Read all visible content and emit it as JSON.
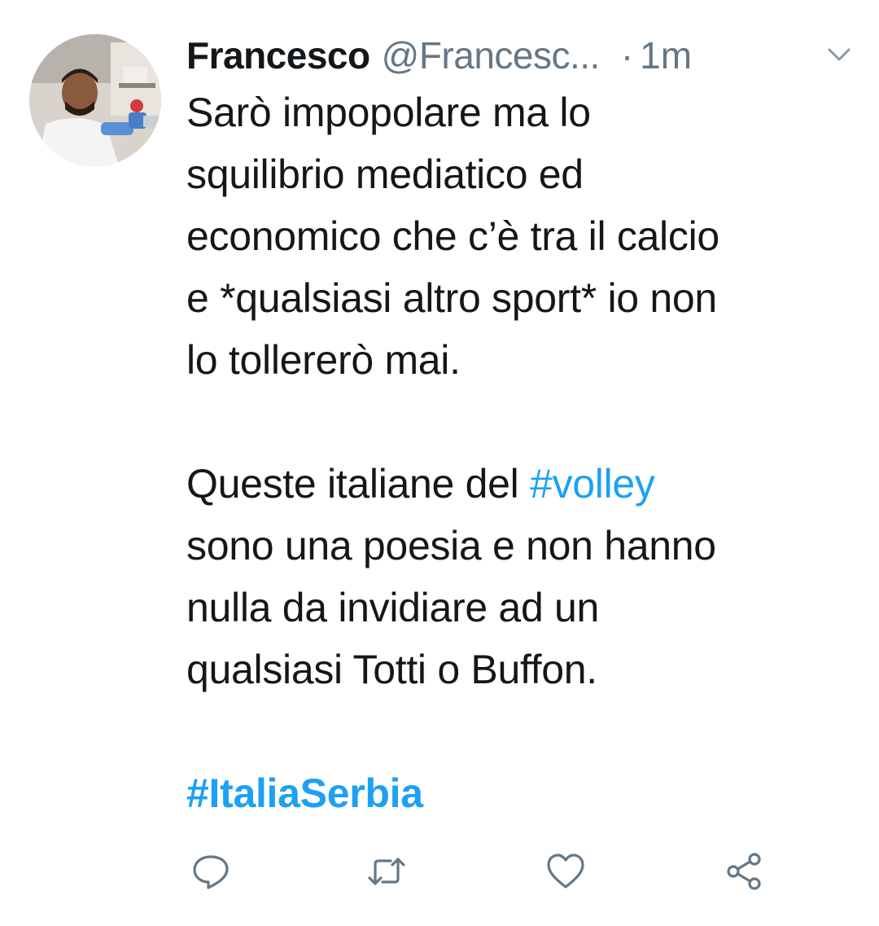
{
  "tweet": {
    "author_name": "Francesco",
    "author_handle": "@Francesc...",
    "separator": "·",
    "time": "1m",
    "body": {
      "paragraph1": {
        "lines": [
          "Sarò impopolare ma lo",
          "squilibrio mediatico ed",
          "economico che c’è tra il calcio",
          "e *qualsiasi altro sport* io non",
          "lo tollererò mai."
        ]
      },
      "paragraph2": {
        "line1_before": "Queste italiane del ",
        "line1_hashtag": "#volley",
        "lines_rest": [
          "sono una poesia e non hanno",
          "nulla da invidiare ad un",
          "qualsiasi Totti o Buffon."
        ]
      },
      "hashtag_line": "#ItaliaSerbia"
    },
    "icons": {
      "avatar": "avatar-photo",
      "caret": "chevron-down-icon",
      "reply": "reply-icon",
      "retweet": "retweet-icon",
      "like": "heart-icon",
      "share": "share-icon"
    },
    "colors": {
      "text": "#14171a",
      "secondary": "#657786",
      "link": "#1da1f2"
    }
  }
}
